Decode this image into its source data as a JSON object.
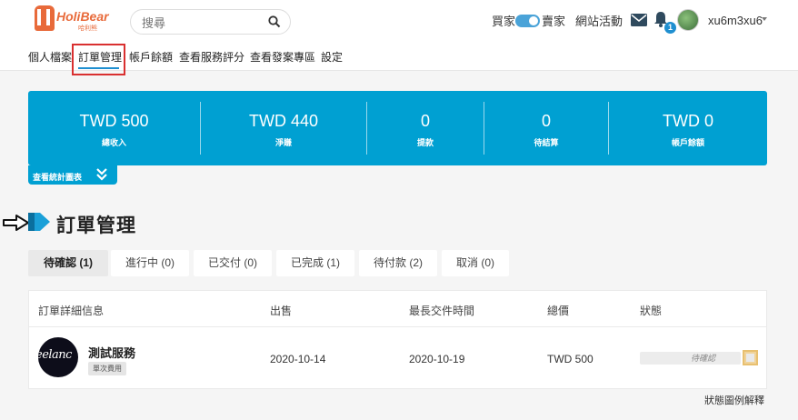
{
  "header": {
    "logo_text": "HoliBear",
    "logo_sub": "哈利熊",
    "search_placeholder": "搜尋",
    "buyer_label": "買家",
    "seller_label": "賣家",
    "events_label": "網站活動",
    "notification_count": "1",
    "username": "xu6m3xu6"
  },
  "subnav": {
    "items": [
      {
        "label": "個人檔案"
      },
      {
        "label": "訂單管理"
      },
      {
        "label": "帳戶餘額"
      },
      {
        "label": "查看服務評分"
      },
      {
        "label": "查看發案專區"
      },
      {
        "label": "設定"
      }
    ]
  },
  "stats": {
    "items": [
      {
        "value": "TWD 500",
        "label": "總收入"
      },
      {
        "value": "TWD 440",
        "label": "淨賺"
      },
      {
        "value": "0",
        "label": "提款"
      },
      {
        "value": "0",
        "label": "待結算"
      },
      {
        "value": "TWD 0",
        "label": "帳戶餘額"
      }
    ],
    "toggle_label": "查看統計圖表"
  },
  "section_title": "訂單管理",
  "tabs": [
    {
      "label": "待確認 (1)"
    },
    {
      "label": "進行中 (0)"
    },
    {
      "label": "已交付 (0)"
    },
    {
      "label": "已完成 (1)"
    },
    {
      "label": "待付款 (2)"
    },
    {
      "label": "取消 (0)"
    }
  ],
  "table": {
    "headers": [
      "訂單詳細信息",
      "出售",
      "最長交件時間",
      "總價",
      "狀態"
    ],
    "rows": [
      {
        "logo_text": "eelanc",
        "service_name": "測試服務",
        "fee_type": "單次費用",
        "sold_date": "2020-10-14",
        "deadline": "2020-10-19",
        "total": "TWD 500",
        "status": "待確認"
      }
    ]
  },
  "legend_link": "狀態圖例解釋",
  "colors": {
    "banner": "#00a0d2",
    "brand": "#e86a3a",
    "active_outline": "#d93030",
    "underline": "#1f8fd0"
  }
}
